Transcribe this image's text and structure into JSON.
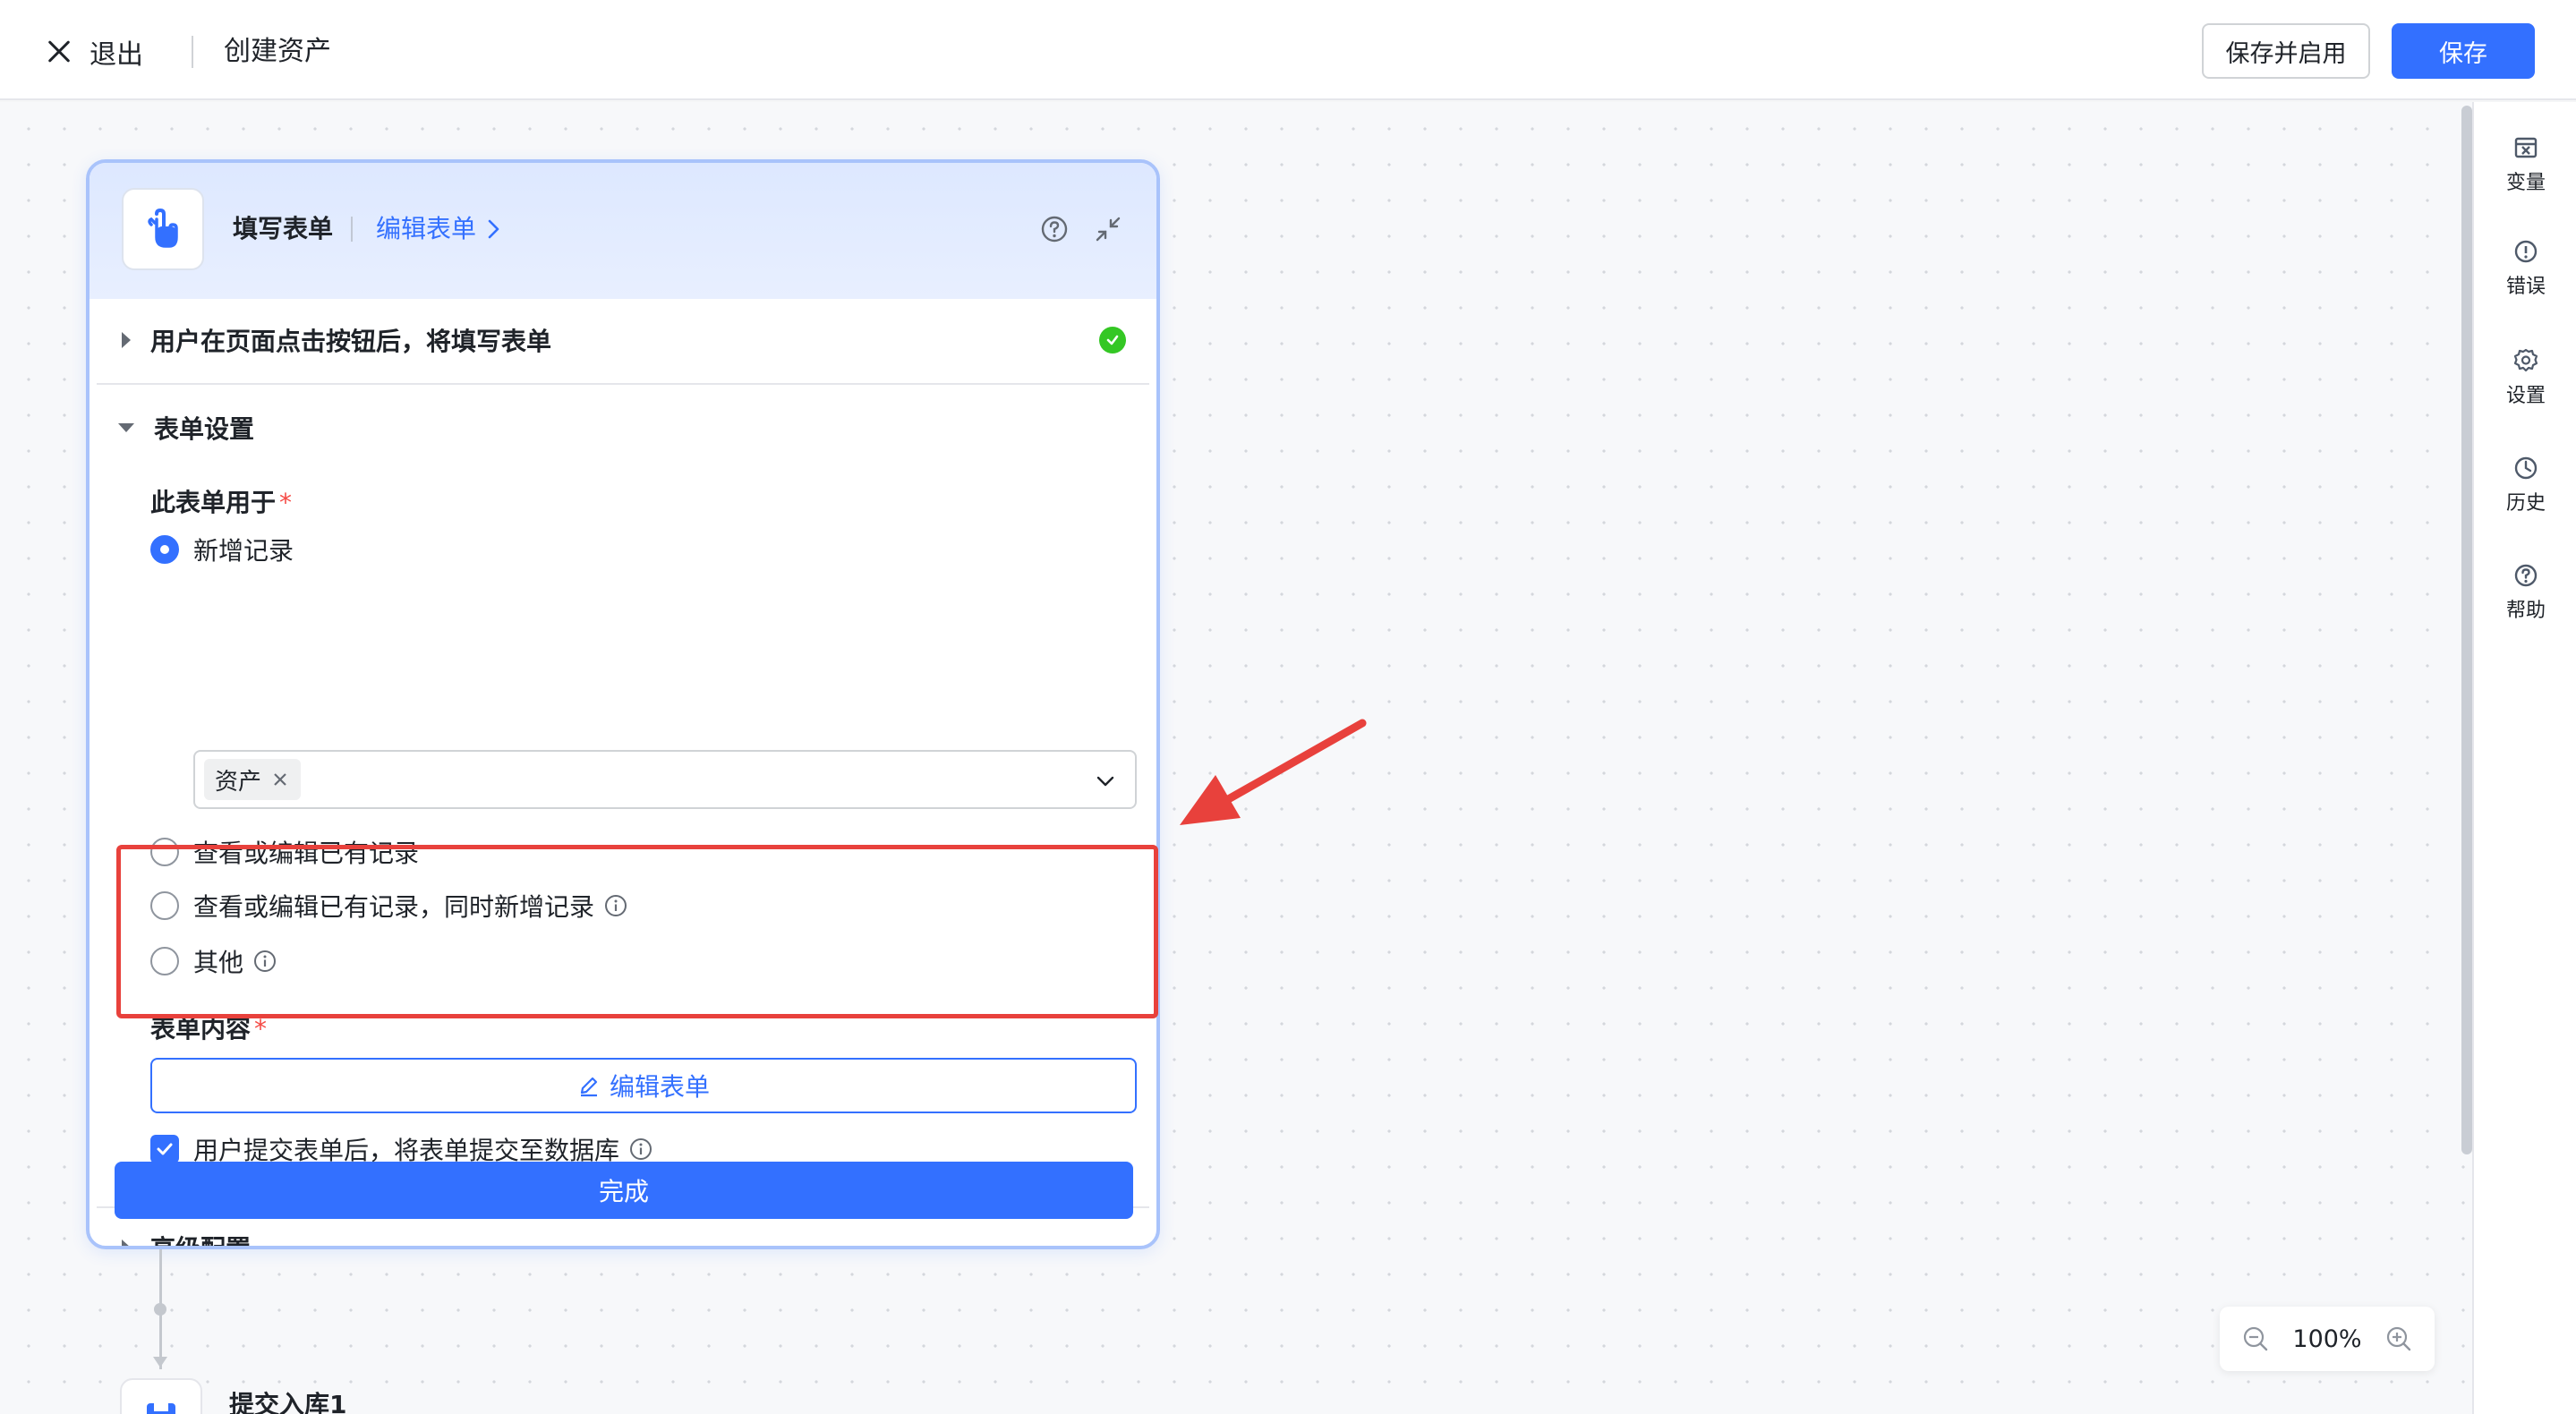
{
  "header": {
    "exit_label": "退出",
    "page_title": "创建资产",
    "save_enable_label": "保存并启用",
    "save_label": "保存"
  },
  "right_rail": {
    "items": [
      {
        "label": "变量",
        "icon": "variable-icon"
      },
      {
        "label": "错误",
        "icon": "error-icon"
      },
      {
        "label": "设置",
        "icon": "gear-icon"
      },
      {
        "label": "历史",
        "icon": "history-icon"
      },
      {
        "label": "帮助",
        "icon": "help-icon"
      }
    ]
  },
  "node": {
    "title": "填写表单",
    "edit_link": "编辑表单",
    "trigger_section": "用户在页面点击按钮后，将填写表单",
    "trigger_status": "success",
    "settings_section": "表单设置",
    "usage_label": "此表单用于",
    "required_mark": "*",
    "options": [
      {
        "label": "新增记录",
        "selected": true
      },
      {
        "label": "查看或编辑已有记录",
        "selected": false
      },
      {
        "label": "查看或编辑已有记录，同时新增记录",
        "selected": false,
        "info": true
      },
      {
        "label": "其他",
        "selected": false,
        "info": true
      }
    ],
    "selected_tag": "资产",
    "content_label": "表单内容",
    "edit_form_button": "编辑表单",
    "submit_checkbox_label": "用户提交表单后，将表单提交至数据库",
    "submit_checkbox_checked": true,
    "advanced_section": "高级配置",
    "done_button": "完成"
  },
  "next_node": {
    "label": "提交入库1"
  },
  "zoom": {
    "value": "100%"
  },
  "colors": {
    "primary": "#3370ff",
    "success": "#34c724",
    "annotation": "#e8413c"
  }
}
